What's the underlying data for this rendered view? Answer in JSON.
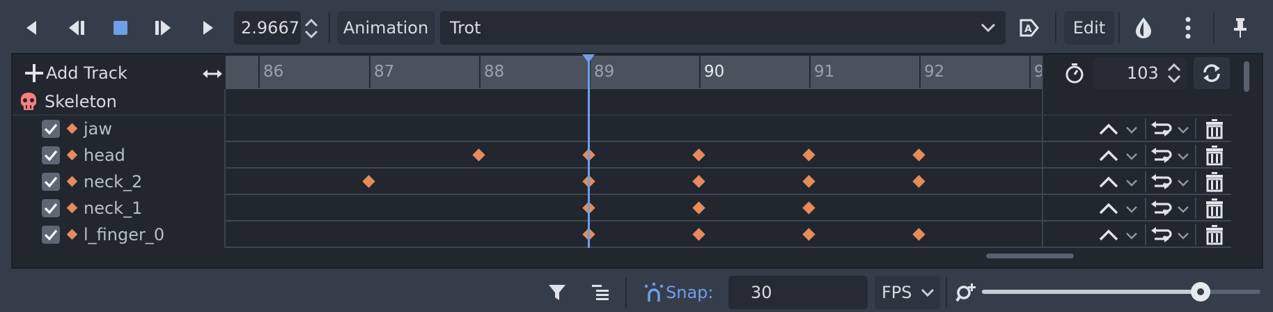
{
  "toolbar": {
    "time_value": "2.9667",
    "animation_label": "Animation",
    "animation_name": "Trot",
    "edit_label": "Edit"
  },
  "track_panel": {
    "add_track_label": "Add Track",
    "node_name": "Skeleton",
    "tracks": [
      {
        "name": "jaw"
      },
      {
        "name": "head"
      },
      {
        "name": "neck_2"
      },
      {
        "name": "neck_1"
      },
      {
        "name": "l_finger_0"
      }
    ]
  },
  "timeline": {
    "frame_labels": [
      "86",
      "87",
      "88",
      "89",
      "90",
      "91",
      "92",
      "9"
    ],
    "current_frame": 89,
    "length_value": "103",
    "keyframes": {
      "jaw": [],
      "head": [
        88,
        89,
        90,
        91,
        92
      ],
      "neck_2": [
        87,
        89,
        90,
        91,
        92
      ],
      "neck_1": [
        89,
        90,
        91
      ],
      "l_finger_0": [
        89,
        90,
        91,
        92
      ]
    }
  },
  "bottom_bar": {
    "snap_label": "Snap:",
    "snap_value": "30",
    "snap_unit": "FPS"
  },
  "colors": {
    "accent": "#6f9fe8",
    "keyframe": "#e88a5a",
    "panel_bg": "#363d4a",
    "field_bg": "#252a35"
  }
}
